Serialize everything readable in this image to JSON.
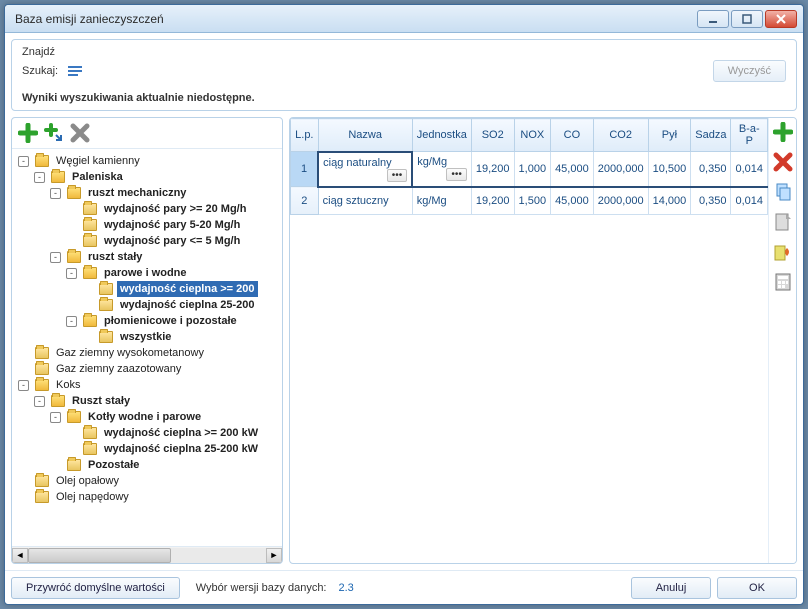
{
  "title": "Baza emisji zanieczyszczeń",
  "search": {
    "title": "Znajdź",
    "label": "Szukaj:",
    "clear": "Wyczyść",
    "empty": "Wyniki wyszukiwania aktualnie niedostępne."
  },
  "tree": {
    "nodes": [
      {
        "depth": 0,
        "toggle": "-",
        "label": "Węgiel kamienny",
        "selected": false,
        "bold": false
      },
      {
        "depth": 1,
        "toggle": "-",
        "label": "Paleniska",
        "selected": false,
        "bold": true
      },
      {
        "depth": 2,
        "toggle": "-",
        "label": "ruszt mechaniczny",
        "selected": false,
        "bold": true
      },
      {
        "depth": 3,
        "toggle": "",
        "label": "wydajność pary >= 20 Mg/h",
        "selected": false,
        "bold": true
      },
      {
        "depth": 3,
        "toggle": "",
        "label": "wydajność pary 5-20 Mg/h",
        "selected": false,
        "bold": true
      },
      {
        "depth": 3,
        "toggle": "",
        "label": "wydajność pary <= 5 Mg/h",
        "selected": false,
        "bold": true
      },
      {
        "depth": 2,
        "toggle": "-",
        "label": "ruszt stały",
        "selected": false,
        "bold": true
      },
      {
        "depth": 3,
        "toggle": "-",
        "label": "parowe i wodne",
        "selected": false,
        "bold": true
      },
      {
        "depth": 4,
        "toggle": "",
        "label": "wydajność cieplna >= 200",
        "selected": true,
        "bold": true
      },
      {
        "depth": 4,
        "toggle": "",
        "label": "wydajność cieplna 25-200",
        "selected": false,
        "bold": true
      },
      {
        "depth": 3,
        "toggle": "-",
        "label": "płomienicowe i pozostałe",
        "selected": false,
        "bold": true
      },
      {
        "depth": 4,
        "toggle": "",
        "label": "wszystkie",
        "selected": false,
        "bold": true
      },
      {
        "depth": 0,
        "toggle": "",
        "label": "Gaz ziemny wysokometanowy",
        "selected": false,
        "bold": false
      },
      {
        "depth": 0,
        "toggle": "",
        "label": "Gaz ziemny zaazotowany",
        "selected": false,
        "bold": false
      },
      {
        "depth": 0,
        "toggle": "-",
        "label": "Koks",
        "selected": false,
        "bold": false
      },
      {
        "depth": 1,
        "toggle": "-",
        "label": "Ruszt stały",
        "selected": false,
        "bold": true
      },
      {
        "depth": 2,
        "toggle": "-",
        "label": "Kotły wodne i parowe",
        "selected": false,
        "bold": true
      },
      {
        "depth": 3,
        "toggle": "",
        "label": "wydajność cieplna >= 200 kW",
        "selected": false,
        "bold": true
      },
      {
        "depth": 3,
        "toggle": "",
        "label": "wydajność cieplna 25-200 kW",
        "selected": false,
        "bold": true
      },
      {
        "depth": 2,
        "toggle": "",
        "label": "Pozostałe",
        "selected": false,
        "bold": true
      },
      {
        "depth": 0,
        "toggle": "",
        "label": "Olej opałowy",
        "selected": false,
        "bold": false
      },
      {
        "depth": 0,
        "toggle": "",
        "label": "Olej napędowy",
        "selected": false,
        "bold": false
      }
    ]
  },
  "grid": {
    "columns": [
      "L.p.",
      "Nazwa",
      "Jednostka",
      "SO2",
      "NOX",
      "CO",
      "CO2",
      "Pył",
      "Sadza",
      "B-a-P"
    ],
    "rows": [
      {
        "n": "1",
        "name": "ciąg naturalny",
        "unit": "kg/Mg",
        "so2": "19,200",
        "nox": "1,000",
        "co": "45,000",
        "co2": "2000,000",
        "pyl": "10,500",
        "sadza": "0,350",
        "bap": "0,014",
        "sel": true
      },
      {
        "n": "2",
        "name": "ciąg sztuczny",
        "unit": "kg/Mg",
        "so2": "19,200",
        "nox": "1,500",
        "co": "45,000",
        "co2": "2000,000",
        "pyl": "14,000",
        "sadza": "0,350",
        "bap": "0,014",
        "sel": false
      }
    ]
  },
  "footer": {
    "restore": "Przywróć domyślne wartości",
    "db_label": "Wybór wersji bazy danych:",
    "db_val": "2.3",
    "cancel": "Anuluj",
    "ok": "OK"
  }
}
